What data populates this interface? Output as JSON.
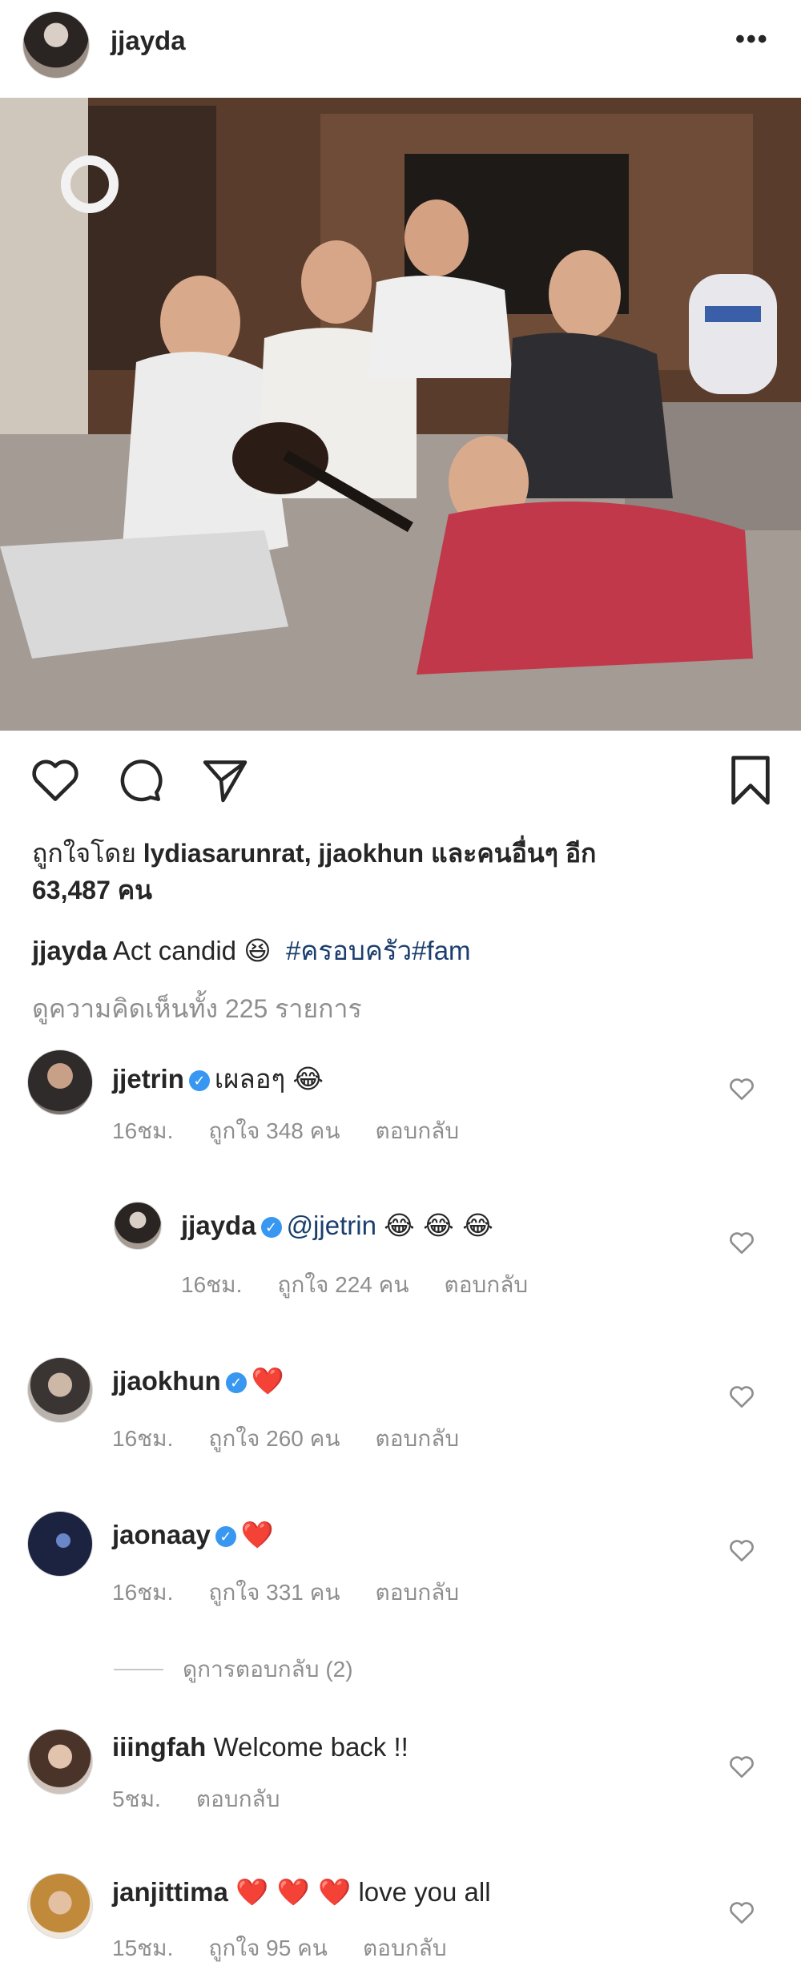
{
  "header": {
    "username": "jjayda",
    "more_icon": "more-horizontal-icon",
    "more_label": "•••"
  },
  "post": {
    "likes_prefix": "ถูกใจโดย ",
    "liked_by_1": "lydiasarunrat",
    "liked_sep": ", ",
    "liked_by_2": "jjaokhun",
    "likes_mid": " และคนอื่นๆ อีก",
    "likes_count": "63,487 คน",
    "caption_user": "jjayda",
    "caption_text": "Act candid",
    "caption_emoji": "😆",
    "caption_hashtags": "#ครอบครัว#fam",
    "view_all_comments": "ดูความคิดเห็นทั้ง 225 รายการ"
  },
  "comments": [
    {
      "user": "jjetrin",
      "verified": true,
      "text": "เผลอๆ",
      "emoji": "😂",
      "time": "16ชม.",
      "likes": "ถูกใจ 348 คน",
      "reply": "ตอบกลับ"
    },
    {
      "user": "jjayda",
      "verified": true,
      "mention": "@jjetrin",
      "emoji": "😂 😂 😂",
      "time": "16ชม.",
      "likes": "ถูกใจ 224 คน",
      "reply": "ตอบกลับ"
    },
    {
      "user": "jjaokhun",
      "verified": true,
      "emoji": "❤️",
      "time": "16ชม.",
      "likes": "ถูกใจ 260 คน",
      "reply": "ตอบกลับ"
    },
    {
      "user": "jaonaay",
      "verified": true,
      "emoji": "❤️",
      "time": "16ชม.",
      "likes": "ถูกใจ 331 คน",
      "reply": "ตอบกลับ"
    },
    {
      "user": "iiingfah",
      "verified": false,
      "text": "Welcome back !!",
      "time": "5ชม.",
      "reply": "ตอบกลับ"
    },
    {
      "user": "janjittima",
      "verified": false,
      "emoji": "❤️ ❤️ ❤️",
      "text": "love you all",
      "time": "15ชม.",
      "likes": "ถูกใจ 95 คน",
      "reply": "ตอบกลับ"
    }
  ],
  "view_replies": "ดูการตอบกลับ (2)",
  "colors": {
    "link": "#1a3e6e",
    "muted": "#8e8e8e",
    "verified": "#3897f0",
    "heart": "#ed4956"
  }
}
